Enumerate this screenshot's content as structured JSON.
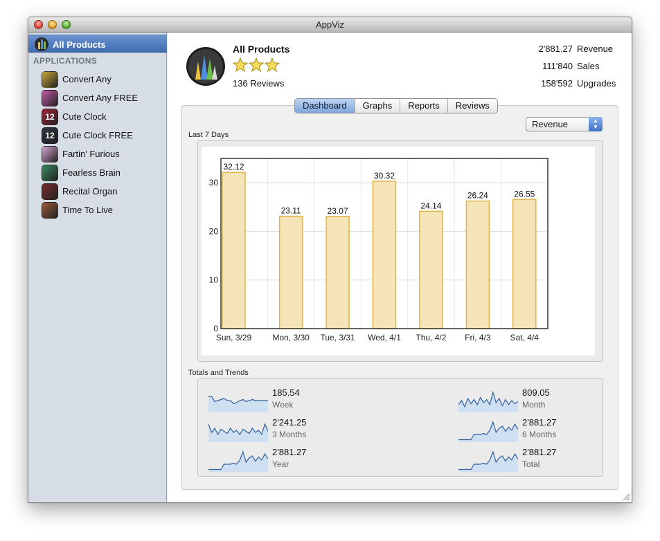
{
  "window": {
    "title": "AppViz"
  },
  "sidebar": {
    "all_products_label": "All Products",
    "section_header": "APPLICATIONS",
    "items": [
      {
        "label": "Convert Any",
        "icon": "convert-any-app-icon",
        "color": "#c9a93a"
      },
      {
        "label": "Convert Any FREE",
        "icon": "convert-any-free-app-icon",
        "color": "#c65aa8"
      },
      {
        "label": "Cute Clock",
        "icon": "cute-clock-app-icon",
        "color": "#a0263a",
        "glyph": "12"
      },
      {
        "label": "Cute Clock FREE",
        "icon": "cute-clock-free-app-icon",
        "color": "#2a3442",
        "glyph": "12"
      },
      {
        "label": "Fartin' Furious",
        "icon": "fartin-furious-app-icon",
        "color": "#d9a2d4"
      },
      {
        "label": "Fearless Brain",
        "icon": "fearless-brain-app-icon",
        "color": "#3b8a62"
      },
      {
        "label": "Recital Organ",
        "icon": "recital-organ-app-icon",
        "color": "#7a2c2c"
      },
      {
        "label": "Time To Live",
        "icon": "time-to-live-app-icon",
        "color": "#9a5a3c"
      }
    ]
  },
  "product": {
    "name": "All Products",
    "stars": 3,
    "reviews": "136 Reviews",
    "stats": [
      {
        "value": "2'881.27",
        "label": "Revenue"
      },
      {
        "value": "111'840",
        "label": "Sales"
      },
      {
        "value": "158'592",
        "label": "Upgrades"
      }
    ]
  },
  "tabs": [
    "Dashboard",
    "Graphs",
    "Reports",
    "Reviews"
  ],
  "active_tab": "Dashboard",
  "metric_select": {
    "value": "Revenue"
  },
  "last7": {
    "label": "Last 7 Days"
  },
  "chart_data": {
    "type": "bar",
    "categories": [
      "Sun, 3/29",
      "Mon, 3/30",
      "Tue, 3/31",
      "Wed, 4/1",
      "Thu, 4/2",
      "Fri, 4/3",
      "Sat, 4/4"
    ],
    "values": [
      32.12,
      23.11,
      23.07,
      30.32,
      24.14,
      26.24,
      26.55
    ],
    "value_labels": [
      "32.12",
      "23.11",
      "23.07",
      "30.32",
      "24.14",
      "26.24",
      "26.55"
    ],
    "yticks": [
      0,
      10,
      20,
      30
    ],
    "ylim": [
      0,
      35
    ],
    "grid": true,
    "bar_fill": "#f5e4b8",
    "bar_stroke": "#e0b54a"
  },
  "totals": {
    "label": "Totals and Trends",
    "items": [
      {
        "value": "185.54",
        "label": "Week"
      },
      {
        "value": "809.05",
        "label": "Month"
      },
      {
        "value": "2'241.25",
        "label": "3 Months"
      },
      {
        "value": "2'881.27",
        "label": "6 Months"
      },
      {
        "value": "2'881.27",
        "label": "Year"
      },
      {
        "value": "2'881.27",
        "label": "Total"
      }
    ]
  }
}
